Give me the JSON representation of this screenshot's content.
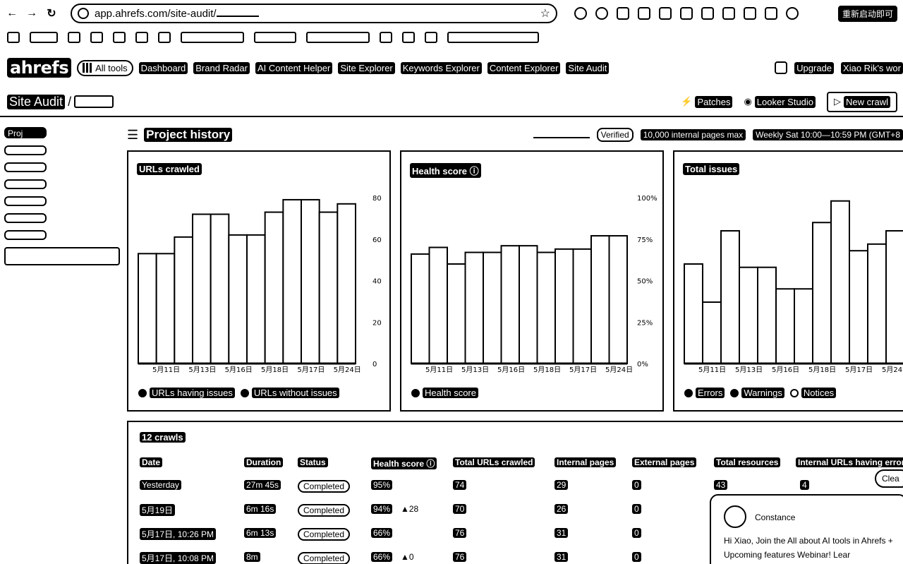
{
  "browser": {
    "url": "app.ahrefs.com/site-audit/",
    "restart_label": "重新启动即可"
  },
  "app_nav": {
    "logo": "ahrefs",
    "all_tools": "All tools",
    "links": [
      "Dashboard",
      "Brand Radar",
      "AI Content Helper",
      "Site Explorer",
      "Keywords Explorer",
      "Content Explorer",
      "Site Audit"
    ],
    "upgrade": "Upgrade",
    "account": "Xiao Rik's wor"
  },
  "page_header": {
    "crumb": "Site Audit",
    "sep": "/",
    "patches": "Patches",
    "looker": "Looker Studio",
    "new_crawl": "New crawl"
  },
  "sidebar": {
    "first_item": "Proj"
  },
  "project_history": {
    "title": "Project history",
    "verified": "Verified",
    "pages_max": "10,000 internal pages max",
    "schedule": "Weekly Sat 10:00—10:59 PM (GMT+8"
  },
  "charts": [
    {
      "title": "URLs crawled",
      "legend": [
        "URLs having issues",
        "URLs without issues"
      ]
    },
    {
      "title": "Health score",
      "legend": [
        "Health score"
      ]
    },
    {
      "title": "Total issues",
      "legend": [
        "Errors",
        "Warnings",
        "Notices"
      ]
    }
  ],
  "chart_data": [
    {
      "type": "bar",
      "title": "URLs crawled",
      "categories": [
        "5月11日",
        "5月13日",
        "5月16日",
        "5月18日",
        "5月17日",
        "5月24日"
      ],
      "values": [
        53,
        53,
        61,
        72,
        72,
        62,
        62,
        73,
        79,
        79,
        73,
        77
      ],
      "ylim": [
        0,
        80
      ],
      "yticks": [
        "0",
        "20",
        "40",
        "60",
        "80"
      ]
    },
    {
      "type": "bar",
      "title": "Health score",
      "categories": [
        "5月11日",
        "5月13日",
        "5月16日",
        "5月18日",
        "5月17日",
        "5月24日"
      ],
      "values": [
        66,
        70,
        60,
        67,
        67,
        71,
        71,
        67,
        69,
        69,
        77,
        77
      ],
      "ylim": [
        0,
        100
      ],
      "yticks": [
        "0%",
        "25%",
        "50%",
        "75%",
        "100%"
      ]
    },
    {
      "type": "bar",
      "title": "Total issues",
      "categories": [
        "5月11日",
        "5月13日",
        "5月16日",
        "5月18日",
        "5月17日",
        "5月24日"
      ],
      "values": [
        60,
        37,
        80,
        58,
        58,
        45,
        45,
        85,
        98,
        68,
        72,
        80
      ],
      "ylim": [
        0,
        100
      ]
    }
  ],
  "crawls": {
    "title": "12 crawls",
    "headers": [
      "Date",
      "Duration",
      "Status",
      "Health score",
      "Total URLs crawled",
      "Internal pages",
      "External pages",
      "Total resources",
      "Internal URLs having error"
    ],
    "rows": [
      {
        "date": "Yesterday",
        "duration": "27m 45s",
        "status": "Completed",
        "health": "95%",
        "delta": "",
        "total_urls": "74",
        "internal": "29",
        "external": "0",
        "resources": "43",
        "errors": "4"
      },
      {
        "date": "5月19日",
        "duration": "6m 16s",
        "status": "Completed",
        "health": "94%",
        "delta": "28",
        "total_urls": "70",
        "internal": "26",
        "external": "0",
        "resources": "",
        "errors": ""
      },
      {
        "date": "5月17日, 10:26 PM",
        "duration": "6m 13s",
        "status": "Completed",
        "health": "66%",
        "delta": "",
        "total_urls": "76",
        "internal": "31",
        "external": "0",
        "resources": "",
        "errors": ""
      },
      {
        "date": "5月17日, 10:08 PM",
        "duration": "8m",
        "status": "Completed",
        "health": "66%",
        "delta": "0",
        "total_urls": "76",
        "internal": "31",
        "external": "0",
        "resources": "",
        "errors": ""
      }
    ],
    "clear": "Clea"
  },
  "chat": {
    "name": "Constance",
    "message": "Hi Xiao,  Join the All about AI tools in Ahrefs + Upcoming features Webinar! Lear"
  }
}
